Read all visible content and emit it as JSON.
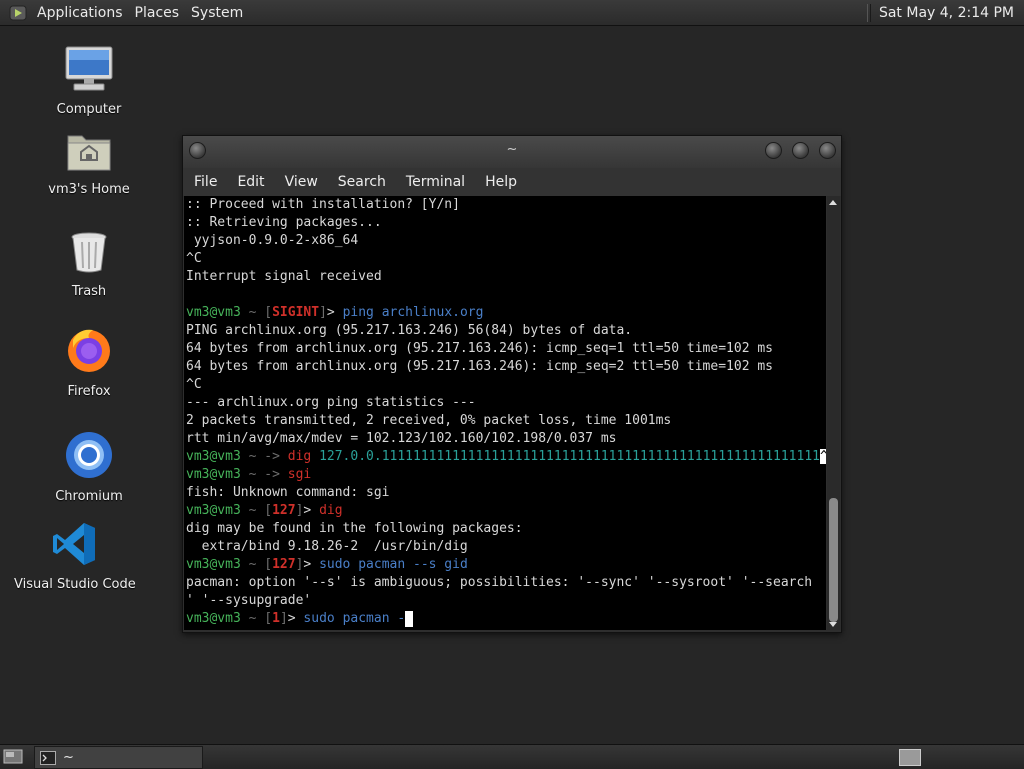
{
  "top_panel": {
    "menus": [
      "Applications",
      "Places",
      "System"
    ],
    "clock": "Sat May  4,  2:14 PM"
  },
  "desktop": {
    "icons": [
      {
        "label": "Computer",
        "icon": "computer-icon"
      },
      {
        "label": "vm3's Home",
        "icon": "home-folder-icon"
      },
      {
        "label": "Trash",
        "icon": "trash-icon"
      },
      {
        "label": "Firefox",
        "icon": "firefox-icon"
      },
      {
        "label": "Chromium",
        "icon": "chromium-icon"
      },
      {
        "label": "Visual Studio Code",
        "icon": "vscode-icon"
      }
    ]
  },
  "terminal": {
    "title": "~",
    "menus": [
      "File",
      "Edit",
      "View",
      "Search",
      "Terminal",
      "Help"
    ],
    "lines": [
      ":: Proceed with installation? [Y/n]",
      ":: Retrieving packages...",
      " yyjson-0.9.0-2-x86_64",
      "^C",
      "Interrupt signal received",
      "",
      "PING archlinux.org (95.217.163.246) 56(84) bytes of data.",
      "64 bytes from archlinux.org (95.217.163.246): icmp_seq=1 ttl=50 time=102 ms",
      "64 bytes from archlinux.org (95.217.163.246): icmp_seq=2 ttl=50 time=102 ms",
      "^C",
      "--- archlinux.org ping statistics ---",
      "2 packets transmitted, 2 received, 0% packet loss, time 1001ms",
      "rtt min/avg/max/mdev = 102.123/102.160/102.198/0.037 ms",
      "fish: Unknown command: sgi",
      "dig may be found in the following packages:",
      "  extra/bind 9.18.26-2  /usr/bin/dig",
      "pacman: option '--s' is ambiguous; possibilities: '--sync' '--sysroot' '--search",
      "' '--sysupgrade'"
    ],
    "prompt_user": "vm3@vm3",
    "prompt_dir": "~",
    "prompt_arrow": "->",
    "prompt_gt": ">",
    "prompt_lb": "[",
    "prompt_rb": "]",
    "status_sigint": "SIGINT",
    "status_127": "127",
    "status_1": "1",
    "cmd_ping": "ping",
    "cmd_ping_arg": "archlinux.org",
    "cmd_dig": "dig",
    "cmd_dig_arg": "127.0.0.11111111111111111111111111111111111111111111111111111111",
    "ctrl_c": "^C",
    "cmd_sgi": "sgi",
    "cmd_dig2": "dig",
    "cmd_sudo": "sudo",
    "cmd_pacman_s_gid": "pacman --s gid",
    "cmd_pacman_partial": "pacman -"
  },
  "taskbar": {
    "task_label": "~"
  }
}
